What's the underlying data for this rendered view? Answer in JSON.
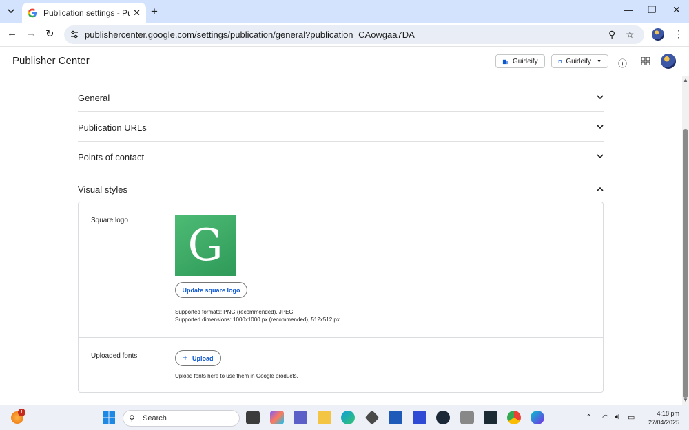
{
  "browser": {
    "tab_title": "Publication settings - Publisher",
    "url": "publishercenter.google.com/settings/publication/general?publication=CAowgaa7DA"
  },
  "header": {
    "app_title": "Publisher Center",
    "pill_1": "Guideify",
    "pill_2": "Guideify"
  },
  "sections": [
    {
      "title": "General",
      "state": "collapsed"
    },
    {
      "title": "Publication URLs",
      "state": "collapsed"
    },
    {
      "title": "Points of contact",
      "state": "collapsed"
    },
    {
      "title": "Visual styles",
      "state": "expanded"
    }
  ],
  "visual_styles": {
    "square_logo_label": "Square logo",
    "logo_letter": "G",
    "update_logo_button": "Update square logo",
    "formats_text": "Supported formats: PNG (recommended), JPEG",
    "dimensions_text": "Supported dimensions: 1000x1000 px (recommended), 512x512 px",
    "fonts_label": "Uploaded fonts",
    "upload_button": "Upload",
    "fonts_help": "Upload fonts here to use them in Google products."
  },
  "taskbar": {
    "search_placeholder": "Search",
    "time": "4:18 pm",
    "date": "27/04/2025",
    "notification_count": "1"
  },
  "colors": {
    "accent": "#0b57d0",
    "logo_green": "#3aa963",
    "tab_bar": "#d3e3fd"
  }
}
